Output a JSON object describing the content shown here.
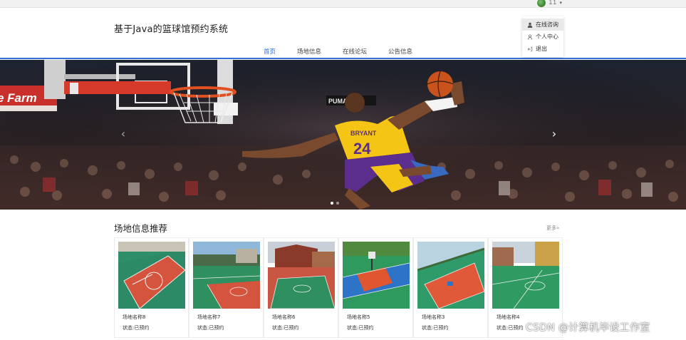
{
  "topbar": {
    "username": "11",
    "caret": "▾"
  },
  "header": {
    "title": "基于Java的篮球馆预约系统"
  },
  "nav": [
    {
      "label": "首页",
      "active": true
    },
    {
      "label": "场地信息",
      "active": false
    },
    {
      "label": "在线论坛",
      "active": false
    },
    {
      "label": "公告信息",
      "active": false
    }
  ],
  "user_menu": [
    {
      "label": "在线咨询",
      "icon": "user-solid-icon"
    },
    {
      "label": "个人中心",
      "icon": "user-outline-icon"
    },
    {
      "label": "退出",
      "icon": "logout-icon"
    }
  ],
  "banner": {
    "prev": "‹",
    "next": "›",
    "slide_count": 2,
    "active_slide": 1,
    "jersey_name": "BRYANT",
    "jersey_number": "24",
    "court_sign": "e Farm",
    "brand_sign": "PUMA"
  },
  "recommend": {
    "title": "场地信息推荐",
    "more": "更多»",
    "items": [
      {
        "name": "场地名称8",
        "status": "状态:已预约"
      },
      {
        "name": "场地名称7",
        "status": "状态:已预约"
      },
      {
        "name": "场地名称6",
        "status": "状态:已预约"
      },
      {
        "name": "场地名称5",
        "status": "状态:已预约"
      },
      {
        "name": "场地名称3",
        "status": "状态:已预约"
      },
      {
        "name": "场地名称4",
        "status": "状态:已预约"
      }
    ]
  },
  "watermark": "CSDN @计算机毕设工作室"
}
